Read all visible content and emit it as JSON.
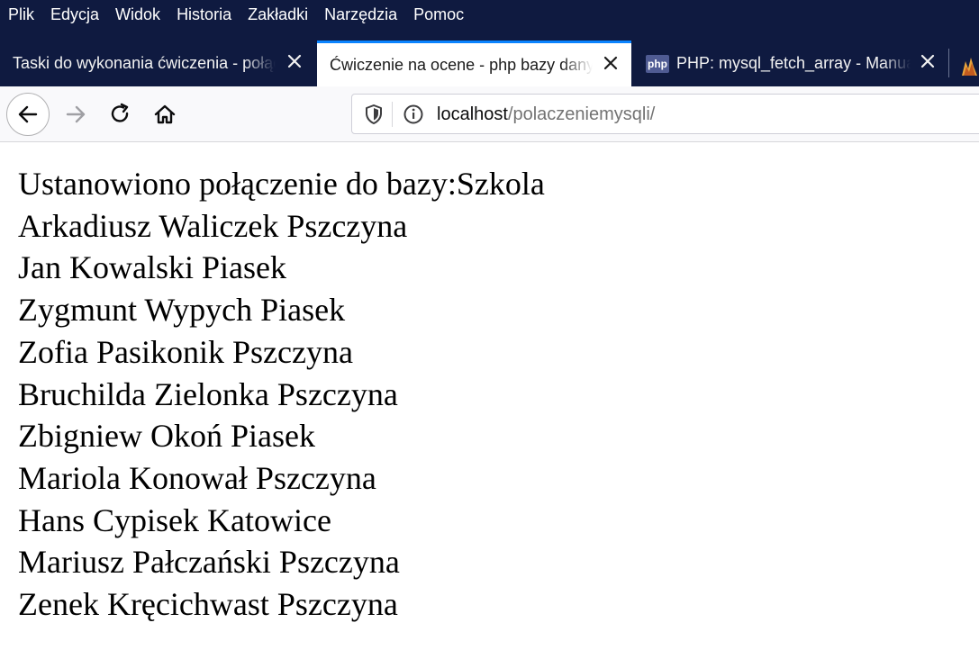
{
  "menu": [
    "Plik",
    "Edycja",
    "Widok",
    "Historia",
    "Zakładki",
    "Narzędzia",
    "Pomoc"
  ],
  "tabs": [
    {
      "label": "Taski do wykonania ćwiczenia - połączenie",
      "active": false
    },
    {
      "label": "Ćwiczenie na ocene - php bazy danych",
      "active": true
    },
    {
      "label": "PHP: mysql_fetch_array - Manual",
      "active": false,
      "favicon": "php"
    }
  ],
  "url": {
    "host": "localhost",
    "path": "/polaczeniemysqli/"
  },
  "page": {
    "status": "Ustanowiono połączenie do bazy:Szkola",
    "records": [
      "Arkadiusz Waliczek Pszczyna",
      "Jan Kowalski Piasek",
      "Zygmunt Wypych Piasek",
      "Zofia Pasikonik Pszczyna",
      "Bruchilda Zielonka Pszczyna",
      "Zbigniew Okoń Piasek",
      "Mariola Konował Pszczyna",
      "Hans Cypisek Katowice",
      "Mariusz Pałczański Pszczyna",
      "Zenek Kręcichwast Pszczyna"
    ]
  },
  "colors": {
    "chrome_dark": "#0f1a40",
    "active_tab_accent": "#0a84ff"
  }
}
